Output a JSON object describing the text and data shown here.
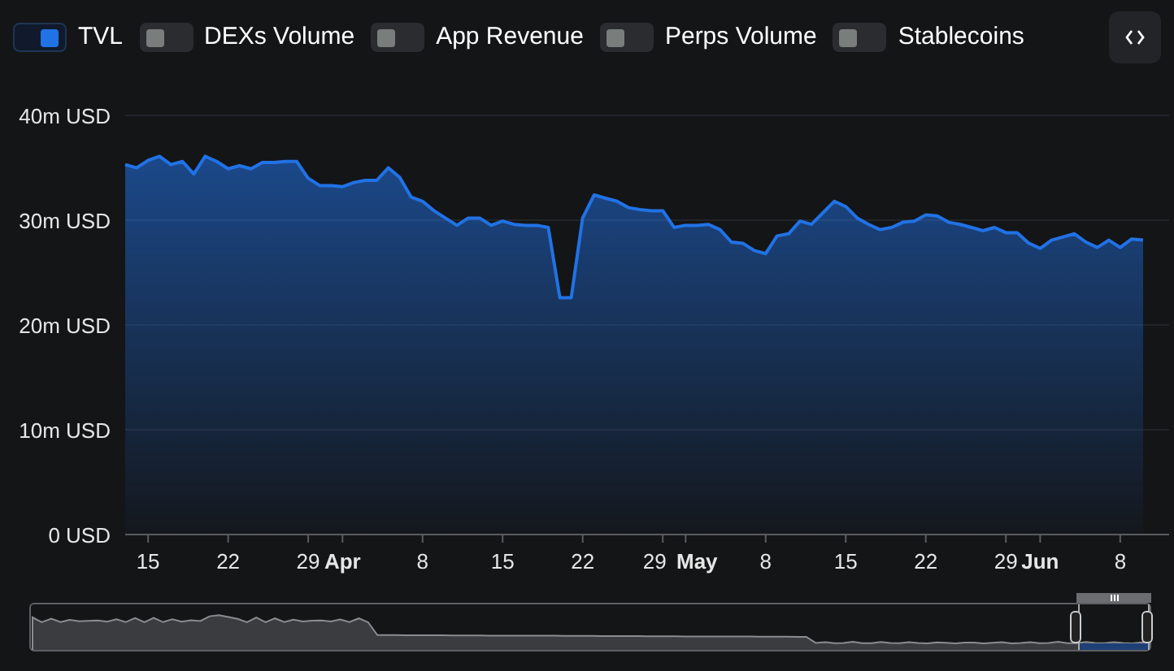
{
  "legend": [
    {
      "label": "TVL",
      "on": true
    },
    {
      "label": "DEXs Volume",
      "on": false
    },
    {
      "label": "App Revenue",
      "on": false
    },
    {
      "label": "Perps Volume",
      "on": false
    },
    {
      "label": "Stablecoins",
      "on": false
    }
  ],
  "chart": {
    "chart_data": {
      "type": "area",
      "grid": true,
      "ylim": [
        0,
        40
      ],
      "yticks": [
        {
          "value": 0,
          "label": "0 USD"
        },
        {
          "value": 10,
          "label": "10m USD"
        },
        {
          "value": 20,
          "label": "20m USD"
        },
        {
          "value": 30,
          "label": "30m USD"
        },
        {
          "value": 40,
          "label": "40m USD"
        }
      ],
      "categories": [
        null,
        null,
        "15",
        null,
        null,
        null,
        null,
        null,
        null,
        "22",
        null,
        null,
        null,
        null,
        null,
        null,
        "29",
        null,
        null,
        "Apr",
        null,
        null,
        null,
        null,
        null,
        null,
        "8",
        null,
        null,
        null,
        null,
        null,
        null,
        "15",
        null,
        null,
        null,
        null,
        null,
        null,
        "22",
        null,
        null,
        null,
        null,
        null,
        null,
        "29",
        null,
        "May",
        null,
        null,
        null,
        null,
        null,
        null,
        "8",
        null,
        null,
        null,
        null,
        null,
        null,
        "15",
        null,
        null,
        null,
        null,
        null,
        null,
        "22",
        null,
        null,
        null,
        null,
        null,
        null,
        "29",
        null,
        null,
        "Jun",
        null,
        null,
        null,
        null,
        null,
        null,
        "8",
        null,
        null
      ],
      "series": [
        {
          "color": "#2172e5",
          "values": [
            35.3,
            35.0,
            35.7,
            36.1,
            35.3,
            35.6,
            34.4,
            36.1,
            35.6,
            34.9,
            35.2,
            34.9,
            35.5,
            35.5,
            35.6,
            35.6,
            34.0,
            33.3,
            33.3,
            33.2,
            33.6,
            33.8,
            33.8,
            35.0,
            34.1,
            32.2,
            31.8,
            30.9,
            30.2,
            29.5,
            30.2,
            30.2,
            29.5,
            29.9,
            29.6,
            29.5,
            29.5,
            29.3,
            22.6,
            22.6,
            30.2,
            32.4,
            32.1,
            31.8,
            31.2,
            31.0,
            30.9,
            30.9,
            29.3,
            29.5,
            29.5,
            29.6,
            29.1,
            27.9,
            27.8,
            27.1,
            26.8,
            28.5,
            28.7,
            29.9,
            29.6,
            30.7,
            31.8,
            31.3,
            30.2,
            29.6,
            29.1,
            29.3,
            29.8,
            29.9,
            30.5,
            30.4,
            29.8,
            29.6,
            29.3,
            29.0,
            29.3,
            28.8,
            28.8,
            27.8,
            27.3,
            28.1,
            28.4,
            28.7,
            27.9,
            27.4,
            28.1,
            27.4,
            28.2,
            28.1
          ]
        }
      ]
    }
  }
}
